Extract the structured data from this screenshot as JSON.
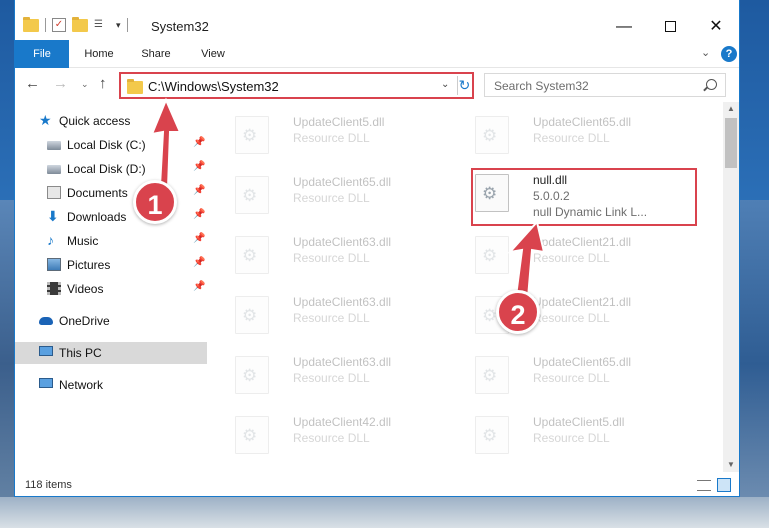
{
  "window": {
    "title": "System32",
    "controls": {
      "minimize": "—",
      "maximize": "",
      "close": "✕"
    }
  },
  "ribbon": {
    "tabs": [
      "File",
      "Home",
      "Share",
      "View"
    ],
    "help": "?"
  },
  "address_bar": {
    "path": "C:\\Windows\\System32",
    "refresh": "↻"
  },
  "search": {
    "placeholder": "Search System32"
  },
  "sidebar": {
    "quick_access": "Quick access",
    "pinned": [
      {
        "label": "Local Disk (C:)",
        "icon": "disk-icon"
      },
      {
        "label": "Local Disk (D:)",
        "icon": "disk-icon"
      },
      {
        "label": "Documents",
        "icon": "documents-icon"
      },
      {
        "label": "Downloads",
        "icon": "download-icon"
      },
      {
        "label": "Music",
        "icon": "music-icon"
      },
      {
        "label": "Pictures",
        "icon": "pictures-icon"
      },
      {
        "label": "Videos",
        "icon": "videos-icon"
      }
    ],
    "onedrive": "OneDrive",
    "this_pc": "This PC",
    "network": "Network"
  },
  "files": {
    "left": [
      {
        "name": "UpdateClient5.dll",
        "desc": "Resource DLL"
      },
      {
        "name": "UpdateClient65.dll",
        "desc": "Resource DLL"
      },
      {
        "name": "UpdateClient63.dll",
        "desc": "Resource DLL"
      },
      {
        "name": "UpdateClient63.dll",
        "desc": "Resource DLL"
      },
      {
        "name": "UpdateClient63.dll",
        "desc": "Resource DLL"
      },
      {
        "name": "UpdateClient42.dll",
        "desc": "Resource DLL"
      }
    ],
    "right": [
      {
        "name": "UpdateClient65.dll",
        "desc": "Resource DLL"
      },
      {
        "name": "null.dll",
        "desc": "5.0.0.2",
        "desc2": "null Dynamic Link L..."
      },
      {
        "name": "UpdateClient21.dll",
        "desc": "Resource DLL"
      },
      {
        "name": "UpdateClient21.dll",
        "desc": "Resource DLL"
      },
      {
        "name": "UpdateClient65.dll",
        "desc": "Resource DLL"
      },
      {
        "name": "UpdateClient5.dll",
        "desc": "Resource DLL"
      }
    ]
  },
  "status": {
    "item_count": "118 items"
  },
  "annotations": {
    "step1": "1",
    "step2": "2",
    "color": "#d9434d"
  }
}
